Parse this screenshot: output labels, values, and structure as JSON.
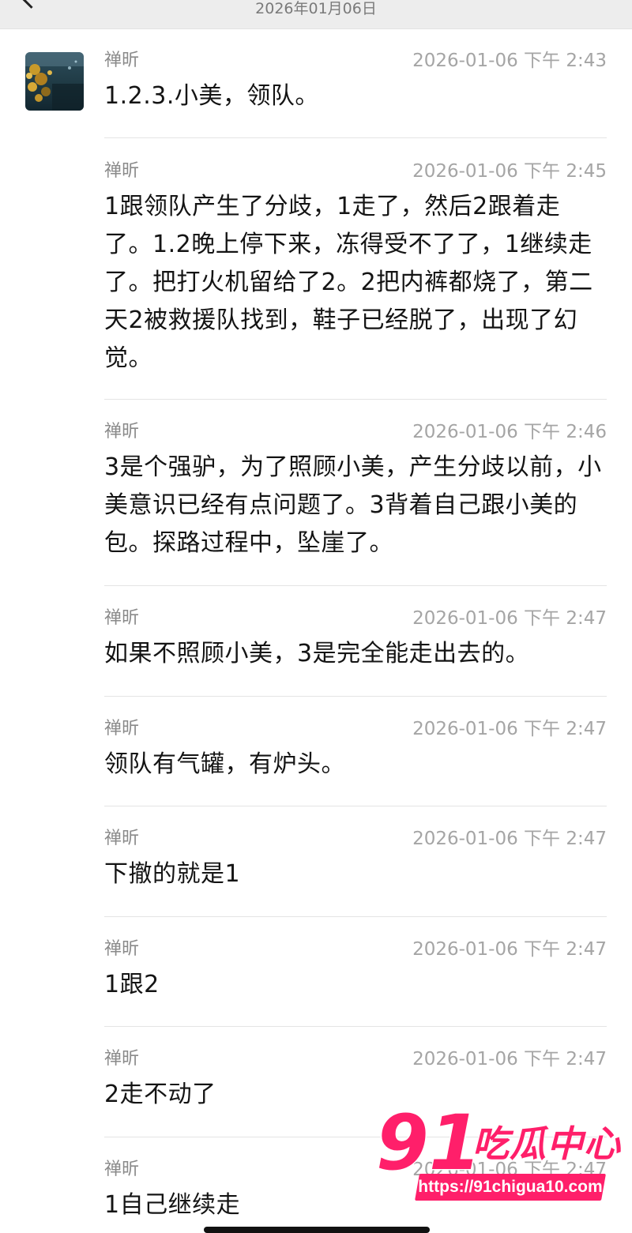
{
  "header": {
    "date": "2026年01月06日"
  },
  "messages": [
    {
      "sender": "禅昕",
      "time": "2026-01-06 下午 2:43",
      "text": "1.2.3.小美，领队。"
    },
    {
      "sender": "禅昕",
      "time": "2026-01-06 下午 2:45",
      "text": "1跟领队产生了分歧，1走了，然后2跟着走了。1.2晚上停下来，冻得受不了了，1继续走了。把打火机留给了2。2把内裤都烧了，第二天2被救援队找到，鞋子已经脱了，出现了幻觉。"
    },
    {
      "sender": "禅昕",
      "time": "2026-01-06 下午 2:46",
      "text": "3是个强驴，为了照顾小美，产生分歧以前，小美意识已经有点问题了。3背着自己跟小美的包。探路过程中，坠崖了。"
    },
    {
      "sender": "禅昕",
      "time": "2026-01-06 下午 2:47",
      "text": "如果不照顾小美，3是完全能走出去的。"
    },
    {
      "sender": "禅昕",
      "time": "2026-01-06 下午 2:47",
      "text": "领队有气罐，有炉头。"
    },
    {
      "sender": "禅昕",
      "time": "2026-01-06 下午 2:47",
      "text": "下撤的就是1"
    },
    {
      "sender": "禅昕",
      "time": "2026-01-06 下午 2:47",
      "text": "1跟2"
    },
    {
      "sender": "禅昕",
      "time": "2026-01-06 下午 2:47",
      "text": "2走不动了"
    },
    {
      "sender": "禅昕",
      "time": "2026-01-06 下午 2:47",
      "text": "1自己继续走"
    }
  ],
  "watermark": {
    "number": "91",
    "brand": "吃瓜中心",
    "url": "https://91chigua10.com"
  },
  "icons": {
    "back": "chevron-left-icon",
    "avatar": "landscape-avatar"
  },
  "colors": {
    "watermark": "#ff1f6a",
    "topbar": "#ededed",
    "timestamp": "#a5a5a5"
  }
}
